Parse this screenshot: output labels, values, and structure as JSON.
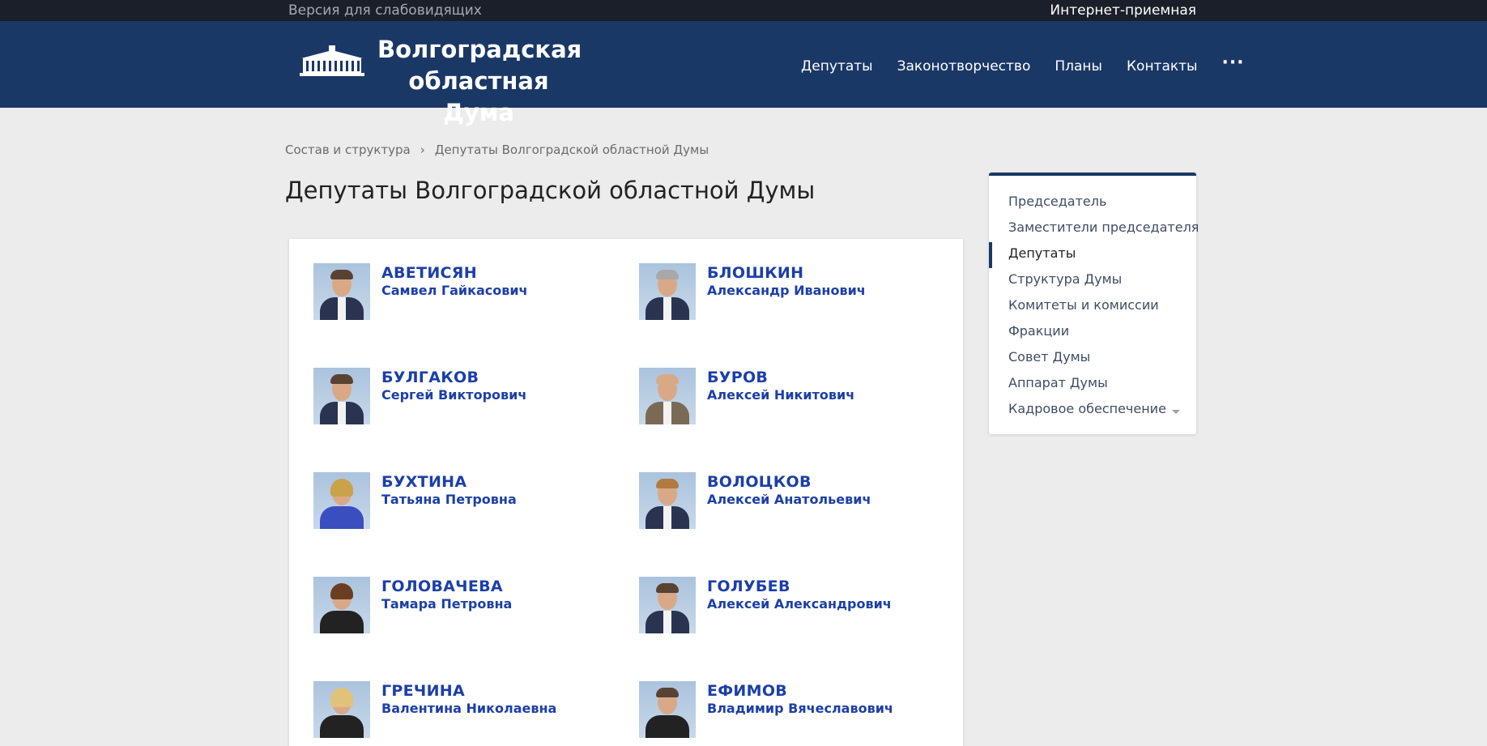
{
  "topbar": {
    "accessibility_label": "Версия для слабовидящих",
    "reception_label": "Интернет-приемная"
  },
  "header": {
    "title_line1": "Волгоградская",
    "title_line2": "областная Дума",
    "nav": [
      "Депутаты",
      "Законотворчество",
      "Планы",
      "Контакты"
    ],
    "more_label": "···"
  },
  "breadcrumb": {
    "items": [
      "Состав и структура",
      "Депутаты Волгоградской областной Думы"
    ],
    "separator": "›"
  },
  "page_title": "Депутаты Волгоградской областной Думы",
  "deputies": [
    {
      "last": "АВЕТИСЯН",
      "first": "Самвел Гайкасович"
    },
    {
      "last": "БЛОШКИН",
      "first": "Александр Иванович"
    },
    {
      "last": "БУЛГАКОВ",
      "first": "Сергей Викторович"
    },
    {
      "last": "БУРОВ",
      "first": "Алексей Никитович"
    },
    {
      "last": "БУХТИНА",
      "first": "Татьяна Петровна"
    },
    {
      "last": "ВОЛОЦКОВ",
      "first": "Алексей Анатольевич"
    },
    {
      "last": "ГОЛОВАЧЕВА",
      "first": "Тамара Петровна"
    },
    {
      "last": "ГОЛУБЕВ",
      "first": "Алексей Александрович"
    },
    {
      "last": "ГРЕЧИНА",
      "first": "Валентина Николаевна"
    },
    {
      "last": "ЕФИМОВ",
      "first": "Владимир Вячеславович"
    }
  ],
  "sidebar": {
    "items": [
      "Председатель",
      "Заместители председателя",
      "Депутаты",
      "Структура Думы",
      "Комитеты и комиссии",
      "Фракции",
      "Совет Думы",
      "Аппарат Думы",
      "Кадровое обеспечение"
    ],
    "active_item": "Депутаты"
  },
  "colors": {
    "header_bg": "#1a3866",
    "topbar_bg": "#1b1f2a",
    "link_blue": "#1c3fa8",
    "page_bg": "#ececec"
  },
  "icons": {
    "logo": "duma-building-logo",
    "more": "ellipsis-icon",
    "expand": "chevron-down-icon"
  }
}
